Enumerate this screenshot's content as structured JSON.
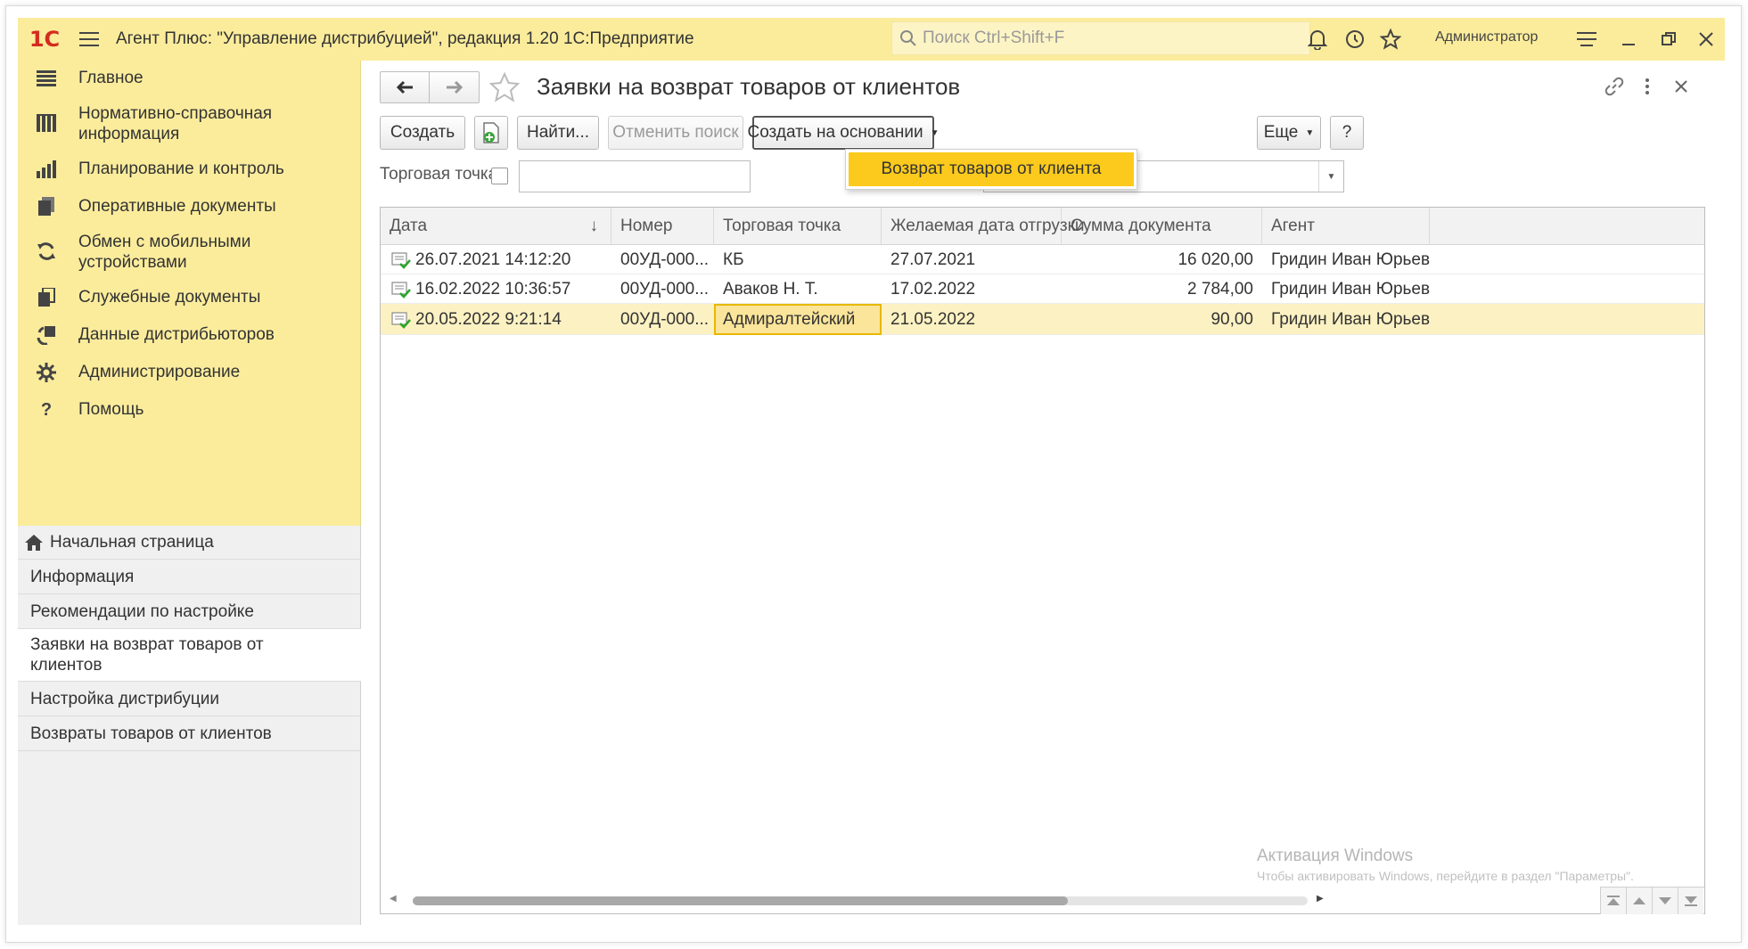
{
  "titlebar": {
    "logo": "1С",
    "title": "Агент Плюс: \"Управление дистрибуцией\", редакция 1.20 1С:Предприятие",
    "search_placeholder": "Поиск Ctrl+Shift+F",
    "user": "Администратор"
  },
  "sections": [
    {
      "label": "Главное",
      "icon": "menu-list-icon"
    },
    {
      "label": "Нормативно-справочная информация",
      "icon": "catalog-icon"
    },
    {
      "label": "Планирование и контроль",
      "icon": "bar-chart-icon"
    },
    {
      "label": "Оперативные документы",
      "icon": "documents-icon"
    },
    {
      "label": "Обмен с мобильными устройствами",
      "icon": "sync-icon"
    },
    {
      "label": "Служебные документы",
      "icon": "service-docs-icon"
    },
    {
      "label": "Данные дистрибьюторов",
      "icon": "distributor-icon"
    },
    {
      "label": "Администрирование",
      "icon": "gear-icon"
    },
    {
      "label": "Помощь",
      "icon": "question-icon"
    }
  ],
  "nav": [
    {
      "label": "Начальная страница"
    },
    {
      "label": "Информация"
    },
    {
      "label": "Рекомендации по настройке"
    },
    {
      "label": "Заявки на возврат товаров от клиентов"
    },
    {
      "label": "Настройка дистрибуции"
    },
    {
      "label": "Возвраты товаров от клиентов"
    }
  ],
  "form": {
    "title": "Заявки на возврат товаров от клиентов",
    "buttons": {
      "create": "Создать",
      "find": "Найти...",
      "cancel_search": "Отменить поиск",
      "create_based_on": "Создать на основании",
      "more": "Еще",
      "help": "?"
    },
    "dropdown_item": "Возврат товаров от клиента",
    "filter_label": "Торговая точка:"
  },
  "table": {
    "columns": [
      "Дата",
      "Номер",
      "Торговая точка",
      "Желаемая дата отгрузки",
      "Сумма документа",
      "Агент"
    ],
    "sort_indicator": "↓",
    "rows": [
      {
        "date": "26.07.2021 14:12:20",
        "number": "00УД-000...",
        "point": "КБ",
        "ship_date": "27.07.2021",
        "sum": "16 020,00",
        "agent": "Гридин Иван Юрьевич"
      },
      {
        "date": "16.02.2022 10:36:57",
        "number": "00УД-000...",
        "point": "Аваков Н. Т.",
        "ship_date": "17.02.2022",
        "sum": "2 784,00",
        "agent": "Гридин Иван Юрьевич"
      },
      {
        "date": "20.05.2022 9:21:14",
        "number": "00УД-000...",
        "point": "Адмиралтейский",
        "ship_date": "21.05.2022",
        "sum": "90,00",
        "agent": "Гридин Иван Юрьевич"
      }
    ]
  },
  "watermark": {
    "line1": "Активация Windows",
    "line2": "Чтобы активировать Windows, перейдите в раздел \"Параметры\"."
  }
}
